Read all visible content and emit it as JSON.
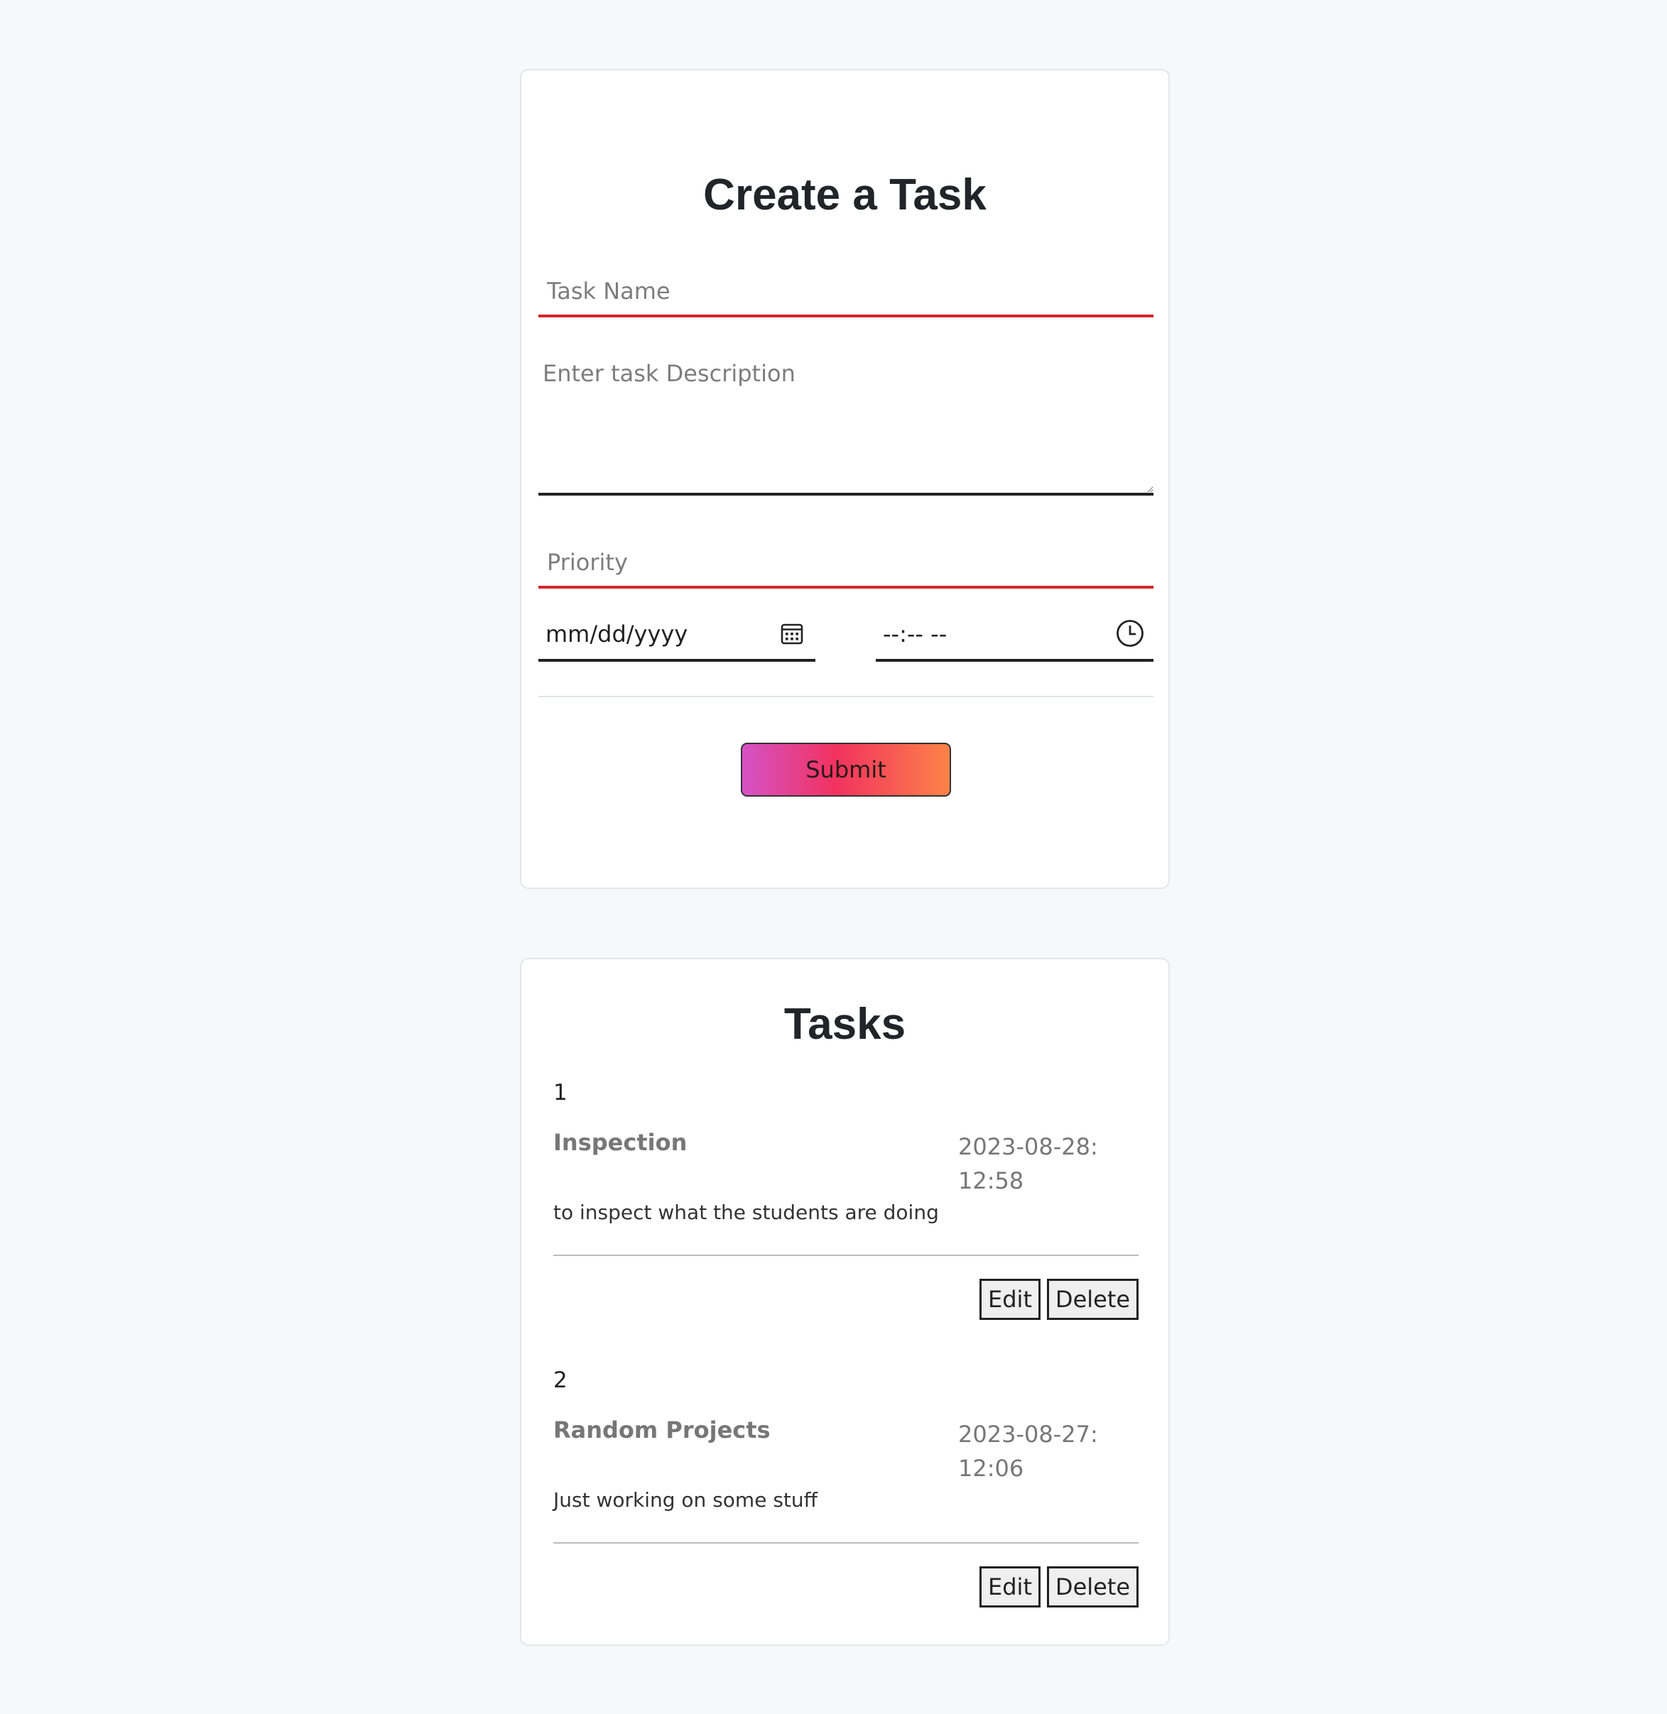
{
  "create_form": {
    "title": "Create a Task",
    "task_name_placeholder": "Task Name",
    "description_placeholder": "Enter task Description",
    "priority_placeholder": "Priority",
    "date_placeholder": "mm/dd/yyyy",
    "time_placeholder": "--:-- --",
    "submit_label": "Submit"
  },
  "tasks_panel": {
    "title": "Tasks",
    "tasks": [
      {
        "number": "1",
        "name": "Inspection",
        "date": "2023-08-28:",
        "time": "12:58",
        "description": "to inspect what the students are doing",
        "edit_label": "Edit",
        "delete_label": "Delete"
      },
      {
        "number": "2",
        "name": "Random Projects",
        "date": "2023-08-27:",
        "time": "12:06",
        "description": "Just working on some stuff",
        "edit_label": "Edit",
        "delete_label": "Delete"
      }
    ]
  },
  "colors": {
    "page_background": "#f7f8fa",
    "required_underline": "#d7262b",
    "submit_gradient": [
      "#d452c6",
      "#f2325f",
      "#fd8347"
    ]
  },
  "icons": {
    "date": "calendar-icon",
    "time": "clock-icon"
  }
}
